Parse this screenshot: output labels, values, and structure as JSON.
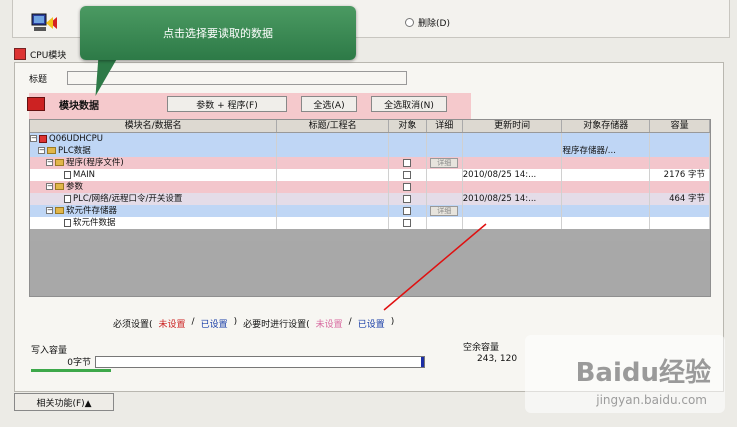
{
  "topbar": {
    "delete_label": "删除(D)"
  },
  "tab": {
    "label": "CPU模块"
  },
  "title_label": "标题",
  "module": {
    "title": "模块数据",
    "buttons": {
      "params": "参数 + 程序(F)",
      "select_all": "全选(A)",
      "deselect_all": "全选取消(N)"
    }
  },
  "grid": {
    "headers": {
      "name": "模块名/数据名",
      "label": "标题/工程名",
      "target": "对象",
      "detail": "详细",
      "time": "更新时间",
      "memory": "对象存储器",
      "size": "容量"
    },
    "rows": [
      {
        "name": "Q06UDHCPU"
      },
      {
        "name": "PLC数据",
        "memory": "程序存储器/..."
      },
      {
        "name": "程序(程序文件)",
        "detail": "详细"
      },
      {
        "name": "MAIN",
        "time": "2010/08/25 14:...",
        "size": "2176 字节"
      },
      {
        "name": "参数"
      },
      {
        "name": "PLC/网络/远程口令/开关设置",
        "time": "2010/08/25 14:...",
        "size": "464 字节"
      },
      {
        "name": "软元件存储器",
        "detail": "详细"
      },
      {
        "name": "软元件数据"
      }
    ]
  },
  "settings": {
    "required": "必须设置(",
    "unset1": "未设置",
    "slash1": "/",
    "set1": "已设置",
    "close1": ")",
    "needed": "必要时进行设置(",
    "unset2": "未设置",
    "slash2": "/",
    "set2": "已设置",
    "close2": ")"
  },
  "capacity": {
    "label": "写入容量",
    "value": "0字节",
    "free_label": "空余容量",
    "free_value": "243, 120"
  },
  "related_button": "相关功能(F)▲",
  "tooltip": "点击选择要读取的数据",
  "watermark": {
    "main": "Baidu经验",
    "sub": "jingyan.baidu.com"
  },
  "colors": {
    "tooltip": "#2d7a47",
    "highlight": "#f3c6cc",
    "selected_row": "#bfd6f5",
    "annotation_line": "#e01010"
  }
}
